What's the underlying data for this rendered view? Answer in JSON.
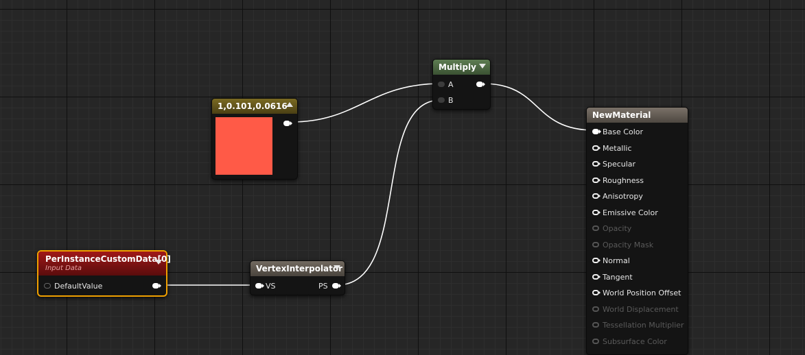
{
  "nodes": {
    "constant": {
      "title": "1,0.101,0.0616",
      "swatch_color": "#ff5a47"
    },
    "multiply": {
      "title": "Multiply",
      "inputs": [
        "A",
        "B"
      ]
    },
    "custom_data": {
      "title": "PerInstanceCustomData[0]",
      "subtitle": "Input Data",
      "input_label": "DefaultValue"
    },
    "interpolator": {
      "title": "VertexInterpolator",
      "input_label": "VS",
      "output_label": "PS"
    },
    "material": {
      "title": "NewMaterial",
      "pins": [
        {
          "label": "Base Color",
          "connected": true,
          "enabled": true
        },
        {
          "label": "Metallic",
          "connected": false,
          "enabled": true
        },
        {
          "label": "Specular",
          "connected": false,
          "enabled": true
        },
        {
          "label": "Roughness",
          "connected": false,
          "enabled": true
        },
        {
          "label": "Anisotropy",
          "connected": false,
          "enabled": true
        },
        {
          "label": "Emissive Color",
          "connected": false,
          "enabled": true
        },
        {
          "label": "Opacity",
          "connected": false,
          "enabled": false
        },
        {
          "label": "Opacity Mask",
          "connected": false,
          "enabled": false
        },
        {
          "label": "Normal",
          "connected": false,
          "enabled": true
        },
        {
          "label": "Tangent",
          "connected": false,
          "enabled": true
        },
        {
          "label": "World Position Offset",
          "connected": false,
          "enabled": true
        },
        {
          "label": "World Displacement",
          "connected": false,
          "enabled": false
        },
        {
          "label": "Tessellation Multiplier",
          "connected": false,
          "enabled": false
        },
        {
          "label": "Subsurface Color",
          "connected": false,
          "enabled": false
        }
      ]
    }
  },
  "colors": {
    "constant_header": "#6b5c1c",
    "multiply_header": "#4f6a44",
    "custom_data_header": "#8c1414",
    "interpolator_header": "#5f5850",
    "material_header": "#6a6259",
    "selection_outline": "#f0a000",
    "wire": "#ffffff"
  }
}
